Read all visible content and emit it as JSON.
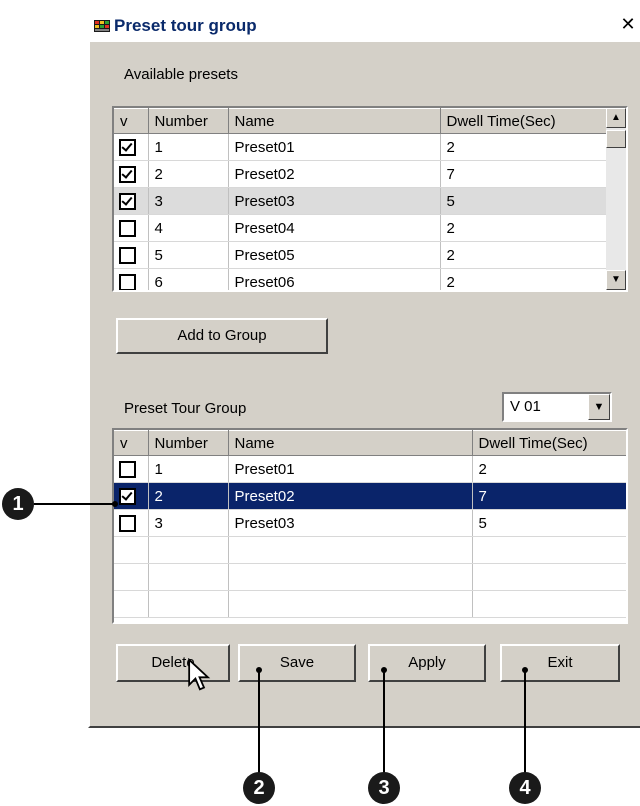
{
  "window": {
    "title": "Preset tour group",
    "close": "✕"
  },
  "available": {
    "label": "Available presets",
    "headers": [
      "v",
      "Number",
      "Name",
      "Dwell Time(Sec)"
    ],
    "rows": [
      {
        "checked": true,
        "number": "1",
        "name": "Preset01",
        "dwell": "2"
      },
      {
        "checked": true,
        "number": "2",
        "name": "Preset02",
        "dwell": "7"
      },
      {
        "checked": true,
        "number": "3",
        "name": "Preset03",
        "dwell": "5"
      },
      {
        "checked": false,
        "number": "4",
        "name": "Preset04",
        "dwell": "2"
      },
      {
        "checked": false,
        "number": "5",
        "name": "Preset05",
        "dwell": "2"
      },
      {
        "checked": false,
        "number": "6",
        "name": "Preset06",
        "dwell": "2"
      }
    ],
    "add_button": "Add to Group"
  },
  "tour": {
    "label": "Preset Tour Group",
    "select_value": "V 01",
    "headers": [
      "v",
      "Number",
      "Name",
      "Dwell Time(Sec)"
    ],
    "rows": [
      {
        "checked": false,
        "number": "1",
        "name": "Preset01",
        "dwell": "2"
      },
      {
        "checked": true,
        "number": "2",
        "name": "Preset02",
        "dwell": "7"
      },
      {
        "checked": false,
        "number": "3",
        "name": "Preset03",
        "dwell": "5"
      }
    ]
  },
  "buttons": {
    "delete": "Delete",
    "save": "Save",
    "apply": "Apply",
    "exit": "Exit"
  },
  "callouts": [
    "1",
    "2",
    "3",
    "4"
  ],
  "colors": {
    "selection": "#0a246a",
    "dialog_bg": "#d4d0c8"
  }
}
